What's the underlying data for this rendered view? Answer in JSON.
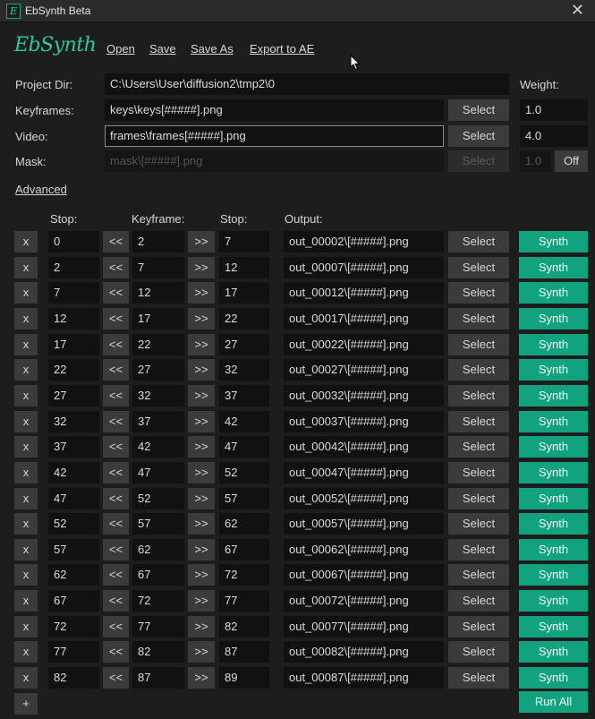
{
  "window": {
    "title": "EbSynth Beta",
    "app_icon_glyph": "E",
    "close_glyph": "✕"
  },
  "logo": "EbSynth",
  "menu": {
    "open": "Open",
    "save": "Save",
    "save_as": "Save As",
    "export": "Export to AE"
  },
  "settings": {
    "project_dir_label": "Project Dir:",
    "project_dir_value": "C:\\Users\\User\\diffusion2\\tmp2\\0",
    "weight_label": "Weight:",
    "keyframes_label": "Keyframes:",
    "keyframes_value": "keys\\keys[#####].png",
    "keyframes_select": "Select",
    "keyframes_weight": "1.0",
    "video_label": "Video:",
    "video_value": "frames\\frames[#####].png",
    "video_select": "Select",
    "video_weight": "4.0",
    "mask_label": "Mask:",
    "mask_value": "mask\\[#####].png",
    "mask_select": "Select",
    "mask_weight": "1.0",
    "mask_toggle": "Off"
  },
  "advanced_label": "Advanced",
  "columns": {
    "stop1": "Stop:",
    "keyframe": "Keyframe:",
    "stop2": "Stop:",
    "output": "Output:"
  },
  "row_labels": {
    "remove": "x",
    "prev": "<<",
    "next": ">>",
    "select": "Select",
    "synth": "Synth"
  },
  "rows": [
    {
      "stop1": "0",
      "keyframe": "2",
      "stop2": "7",
      "output": "out_00002\\[#####].png"
    },
    {
      "stop1": "2",
      "keyframe": "7",
      "stop2": "12",
      "output": "out_00007\\[#####].png"
    },
    {
      "stop1": "7",
      "keyframe": "12",
      "stop2": "17",
      "output": "out_00012\\[#####].png"
    },
    {
      "stop1": "12",
      "keyframe": "17",
      "stop2": "22",
      "output": "out_00017\\[#####].png"
    },
    {
      "stop1": "17",
      "keyframe": "22",
      "stop2": "27",
      "output": "out_00022\\[#####].png"
    },
    {
      "stop1": "22",
      "keyframe": "27",
      "stop2": "32",
      "output": "out_00027\\[#####].png"
    },
    {
      "stop1": "27",
      "keyframe": "32",
      "stop2": "37",
      "output": "out_00032\\[#####].png"
    },
    {
      "stop1": "32",
      "keyframe": "37",
      "stop2": "42",
      "output": "out_00037\\[#####].png"
    },
    {
      "stop1": "37",
      "keyframe": "42",
      "stop2": "47",
      "output": "out_00042\\[#####].png"
    },
    {
      "stop1": "42",
      "keyframe": "47",
      "stop2": "52",
      "output": "out_00047\\[#####].png"
    },
    {
      "stop1": "47",
      "keyframe": "52",
      "stop2": "57",
      "output": "out_00052\\[#####].png"
    },
    {
      "stop1": "52",
      "keyframe": "57",
      "stop2": "62",
      "output": "out_00057\\[#####].png"
    },
    {
      "stop1": "57",
      "keyframe": "62",
      "stop2": "67",
      "output": "out_00062\\[#####].png"
    },
    {
      "stop1": "62",
      "keyframe": "67",
      "stop2": "72",
      "output": "out_00067\\[#####].png"
    },
    {
      "stop1": "67",
      "keyframe": "72",
      "stop2": "77",
      "output": "out_00072\\[#####].png"
    },
    {
      "stop1": "72",
      "keyframe": "77",
      "stop2": "82",
      "output": "out_00077\\[#####].png"
    },
    {
      "stop1": "77",
      "keyframe": "82",
      "stop2": "87",
      "output": "out_00082\\[#####].png"
    },
    {
      "stop1": "82",
      "keyframe": "87",
      "stop2": "89",
      "output": "out_00087\\[#####].png"
    }
  ],
  "footer": {
    "add": "+",
    "run_all": "Run All"
  },
  "colors": {
    "accent": "#12a27e",
    "background": "#1d1d1d",
    "field": "#111111",
    "button": "#3b3b3b"
  }
}
